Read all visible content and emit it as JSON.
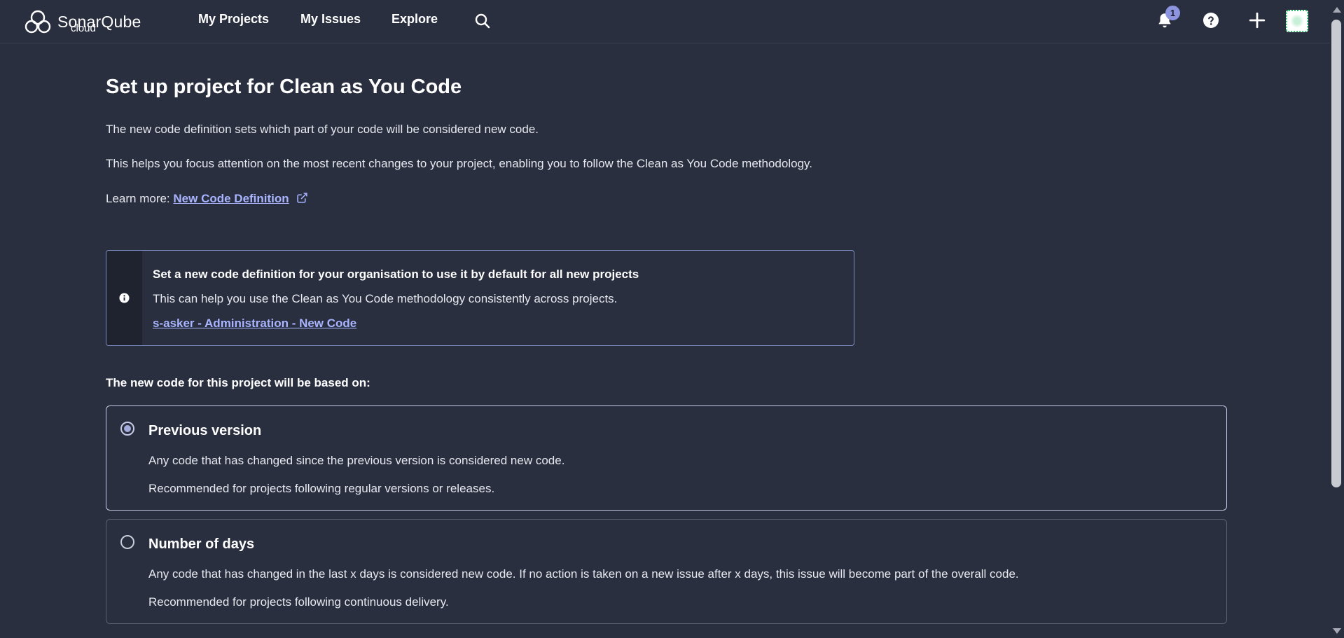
{
  "app": {
    "logo_name": "SonarQube",
    "logo_sub": "cloud"
  },
  "nav": {
    "items": [
      {
        "label": "My Projects"
      },
      {
        "label": "My Issues"
      },
      {
        "label": "Explore"
      }
    ],
    "notification_count": "1"
  },
  "main": {
    "title": "Set up project for Clean as You Code",
    "intro": "The new code definition sets which part of your code will be considered new code.",
    "help": "This helps you focus attention on the most recent changes to your project, enabling you to follow the Clean as You Code methodology.",
    "learn_prefix": "Learn more: ",
    "learn_link": "New Code Definition"
  },
  "info_box": {
    "title": "Set a new code definition for your organisation to use it by default for all new projects",
    "text": "This can help you use the Clean as You Code methodology consistently across projects.",
    "link": "s-asker - Administration - New Code"
  },
  "options_label": "The new code for this project will be based on:",
  "options": [
    {
      "title": "Previous version",
      "selected": true,
      "desc1": "Any code that has changed since the previous version is considered new code.",
      "desc2": "Recommended for projects following regular versions or releases."
    },
    {
      "title": "Number of days",
      "selected": false,
      "desc1": "Any code that has changed in the last x days is considered new code. If no action is taken on a new issue after x days, this issue will become part of the overall code.",
      "desc2": "Recommended for projects following continuous delivery."
    }
  ],
  "colors": {
    "background": "#2a2f40",
    "link": "#a9b4ff",
    "badge": "#8d94e0"
  }
}
